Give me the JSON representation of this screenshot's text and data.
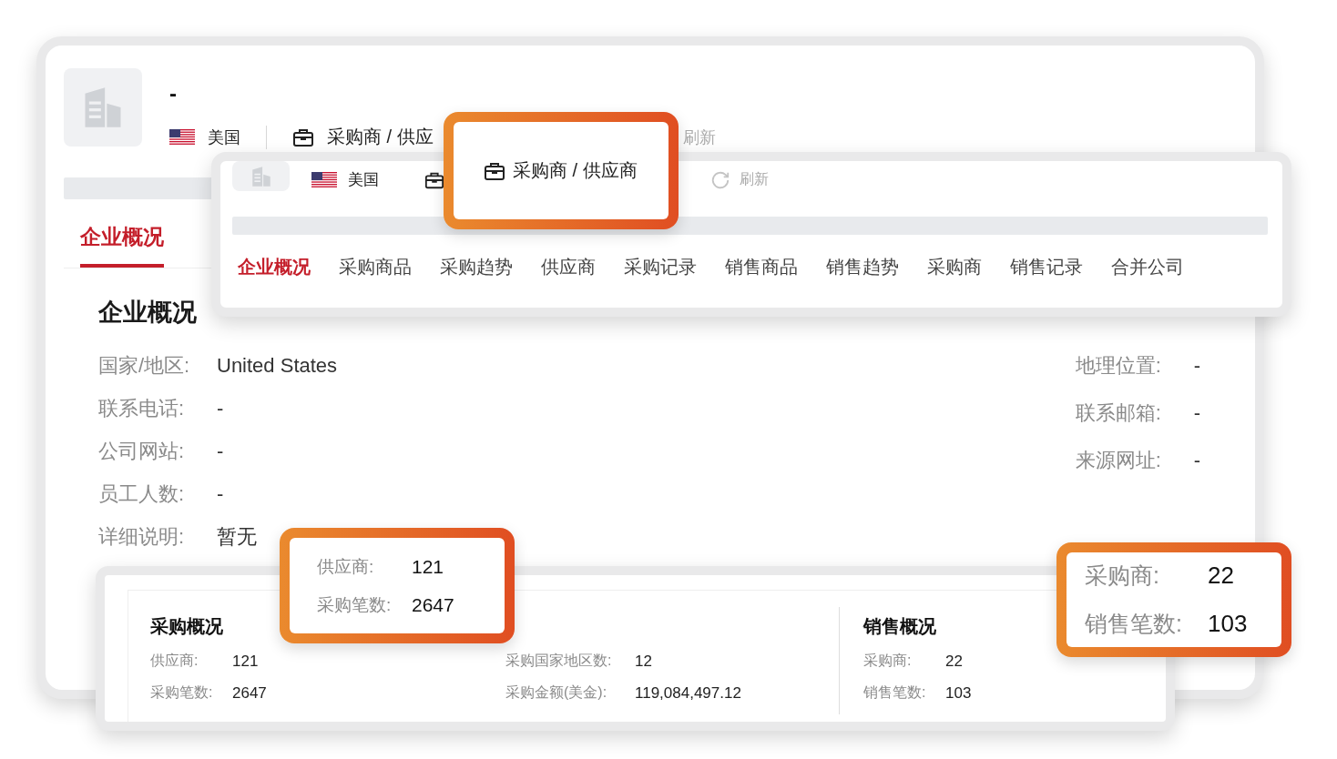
{
  "company_card": {
    "name": "-",
    "country": "美国",
    "role": "采购商 / 供应",
    "refresh": "刷新",
    "tabs": [
      {
        "label": "企业概况",
        "selected": true
      }
    ],
    "section_title": "企业概况",
    "fields_left": [
      {
        "label": "国家/地区:",
        "value": "United States"
      },
      {
        "label": "联系电话:",
        "value": "-"
      },
      {
        "label": "公司网站:",
        "value": "-"
      },
      {
        "label": "员工人数:",
        "value": "-"
      },
      {
        "label": "详细说明:",
        "value": "暂无"
      }
    ],
    "fields_right": [
      {
        "label": "地理位置:",
        "value": "-"
      },
      {
        "label": "联系邮箱:",
        "value": "-"
      },
      {
        "label": "来源网址:",
        "value": "-"
      }
    ]
  },
  "tabs_card": {
    "country": "美国",
    "refresh": "刷新",
    "tabs": [
      {
        "label": "企业概况",
        "selected": true
      },
      {
        "label": "采购商品",
        "selected": false
      },
      {
        "label": "采购趋势",
        "selected": false
      },
      {
        "label": "供应商",
        "selected": false
      },
      {
        "label": "采购记录",
        "selected": false
      },
      {
        "label": "销售商品",
        "selected": false
      },
      {
        "label": "销售趋势",
        "selected": false
      },
      {
        "label": "采购商",
        "selected": false
      },
      {
        "label": "销售记录",
        "selected": false
      },
      {
        "label": "合并公司",
        "selected": false
      }
    ]
  },
  "role_callout": {
    "role": "采购商 / 供应商"
  },
  "overview_card": {
    "sections": [
      {
        "title": "采购概况",
        "columns": [
          [
            {
              "label": "供应商:",
              "value": "121"
            },
            {
              "label": "采购笔数:",
              "value": "2647"
            }
          ],
          [
            {
              "label": "采购国家地区数:",
              "value": "12"
            },
            {
              "label": "采购金额(美金):",
              "value": "119,084,497.12"
            }
          ]
        ]
      },
      {
        "title": "销售概况",
        "columns": [
          [
            {
              "label": "采购商:",
              "value": "22"
            },
            {
              "label": "销售笔数:",
              "value": "103"
            }
          ]
        ]
      }
    ]
  },
  "callouts": [
    {
      "items": [
        {
          "label": "供应商:",
          "value": "121"
        },
        {
          "label": "采购笔数:",
          "value": "2647"
        }
      ]
    },
    {
      "items": [
        {
          "label": "采购商:",
          "value": "22"
        },
        {
          "label": "销售笔数:",
          "value": "103"
        }
      ]
    }
  ]
}
